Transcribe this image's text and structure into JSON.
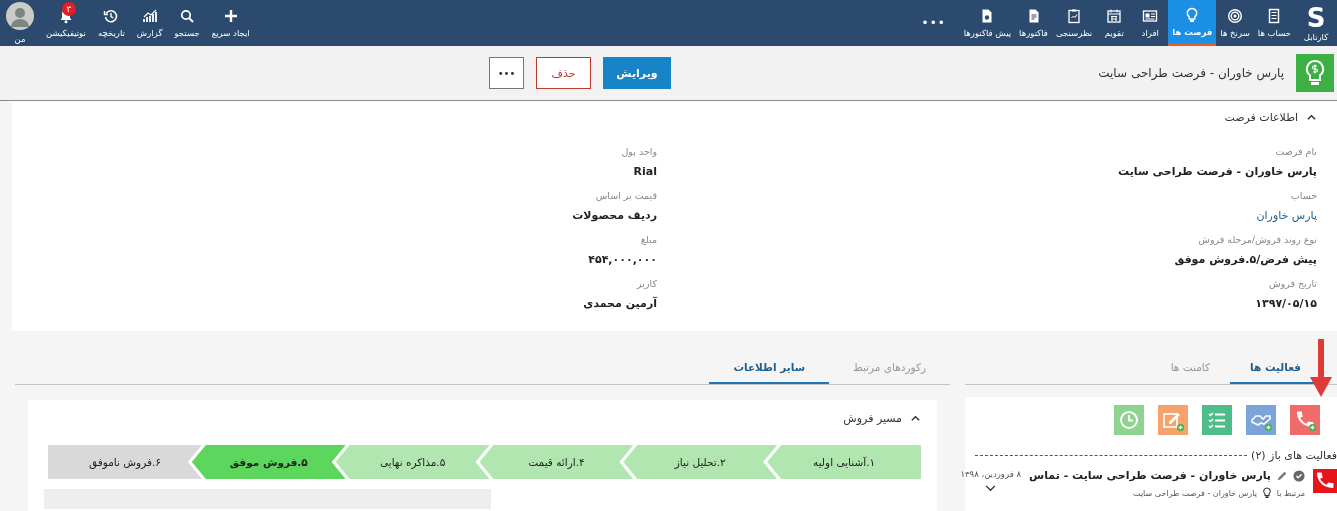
{
  "nav": {
    "logo": {
      "letter": "S",
      "label": "کارتابل"
    },
    "items": [
      {
        "label": "حساب ها",
        "selected": false
      },
      {
        "label": "سرنخ ها",
        "selected": false
      },
      {
        "label": "فرصت ها",
        "selected": true
      },
      {
        "label": "افراد",
        "selected": false
      },
      {
        "label": "تقویم",
        "selected": false
      },
      {
        "label": "نظرسنجی",
        "selected": false
      },
      {
        "label": "فاکتورها",
        "selected": false
      },
      {
        "label": "پیش فاکتورها",
        "selected": false
      }
    ],
    "more": "•••",
    "tools": [
      {
        "label": "ایجاد سریع",
        "kind": "icon"
      },
      {
        "label": "جستجو",
        "kind": "icon"
      },
      {
        "label": "گزارش",
        "kind": "icon"
      },
      {
        "label": "تاریخچه",
        "kind": "icon"
      },
      {
        "label": "نوتیفیکیشن",
        "kind": "icon",
        "badge": "۳"
      },
      {
        "label": "من",
        "kind": "avatar"
      }
    ]
  },
  "header": {
    "title": "پارس خاوران - فرصت طراحی سایت",
    "buttons": [
      {
        "label": "ویرایش",
        "kind": "primary"
      },
      {
        "label": "حذف",
        "kind": "danger"
      },
      {
        "label": "•••",
        "kind": "more"
      }
    ]
  },
  "info": {
    "title": "اطلاعات فرصت",
    "expanded": true,
    "columns": [
      [
        {
          "label": "نام فرصت",
          "value": "پارس خاوران - فرصت طراحی سایت",
          "kind": "text"
        },
        {
          "label": "حساب",
          "value": "پارس خاوران",
          "kind": "link"
        },
        {
          "label": "نوع روند فروش/مرحله فروش",
          "value": "پیش فرض/۵.فروش موفق",
          "kind": "text"
        },
        {
          "label": "تاریخ فروش",
          "value": "۱۳۹۷/۰۵/۱۵",
          "kind": "text"
        }
      ],
      [
        {
          "label": "واحد پول",
          "value": "Rial",
          "kind": "text"
        },
        {
          "label": "قیمت بر اساس",
          "value": "ردیف محصولات",
          "kind": "text"
        },
        {
          "label": "مبلغ",
          "value": "۴۵۴,۰۰۰,۰۰۰",
          "kind": "text"
        },
        {
          "label": "کاربر",
          "value": "آرمین محمدی",
          "kind": "text"
        }
      ]
    ]
  },
  "activity_panel": {
    "tabs": [
      {
        "label": "فعالیت ها",
        "selected": true
      },
      {
        "label": "کامنت ها",
        "selected": false
      }
    ],
    "quick_actions": [
      {
        "color": "#f26b6b"
      },
      {
        "color": "#7ba4db"
      },
      {
        "color": "#4dbd8a"
      },
      {
        "color": "#f5a26c"
      },
      {
        "color": "#8ed38f"
      }
    ],
    "open_title": "فعالیت های باز (۲)",
    "items": [
      {
        "title": "پارس خاوران - فرصت طراحی سایت - تماس",
        "date": "۸ فروردین، ۱۳۹۸",
        "related_label": "مرتبط با",
        "related": "پارس خاوران - فرصت طراحی سایت"
      }
    ]
  },
  "details_panel": {
    "tabs": [
      {
        "label": "رکوردهای مرتبط",
        "selected": false
      },
      {
        "label": "سایر اطلاعات",
        "selected": true
      }
    ],
    "sales_path": {
      "title": "مسیر فروش",
      "expanded": true,
      "stages": [
        {
          "label": "۱.آشنایی اولیه",
          "reached": true,
          "selected": false
        },
        {
          "label": "۲.تحلیل نیاز",
          "reached": true,
          "selected": false
        },
        {
          "label": "۴.ارائه قیمت",
          "reached": true,
          "selected": false
        },
        {
          "label": "۵.مذاکره نهایی",
          "reached": true,
          "selected": false
        },
        {
          "label": "۵.فروش موفق",
          "reached": true,
          "selected": true
        },
        {
          "label": "۶.فروش ناموفق",
          "reached": false,
          "selected": false
        }
      ]
    }
  }
}
